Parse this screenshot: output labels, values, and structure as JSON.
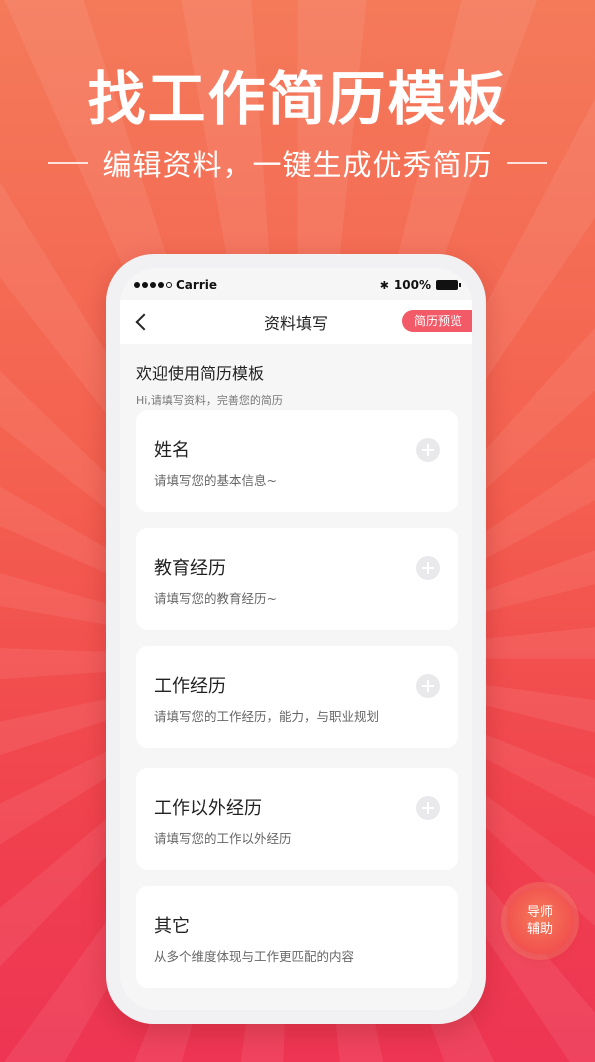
{
  "banner": {
    "title": "找工作简历模板",
    "subtitle": "编辑资料，一键生成优秀简历"
  },
  "status_bar": {
    "carrier": "Carrie",
    "battery": "100%"
  },
  "nav": {
    "title": "资料填写",
    "preview_label": "简历预览"
  },
  "welcome": {
    "title": "欢迎使用简历模板",
    "subtitle": "Hi,请填写资料，完善您的简历"
  },
  "sections": [
    {
      "title": "姓名",
      "desc": "请填写您的基本信息~"
    },
    {
      "title": "教育经历",
      "desc": "请填写您的教育经历~"
    },
    {
      "title": "工作经历",
      "desc": "请填写您的工作经历，能力，与职业规划"
    },
    {
      "title": "工作以外经历",
      "desc": "请填写您的工作以外经历"
    },
    {
      "title": "其它",
      "desc": "从多个维度体现与工作更匹配的内容"
    }
  ],
  "mentor": {
    "line1": "导师",
    "line2": "辅助"
  },
  "colors": {
    "accent": "#f25a68",
    "background_top": "#f47a5a",
    "background_bottom": "#ee3554"
  }
}
